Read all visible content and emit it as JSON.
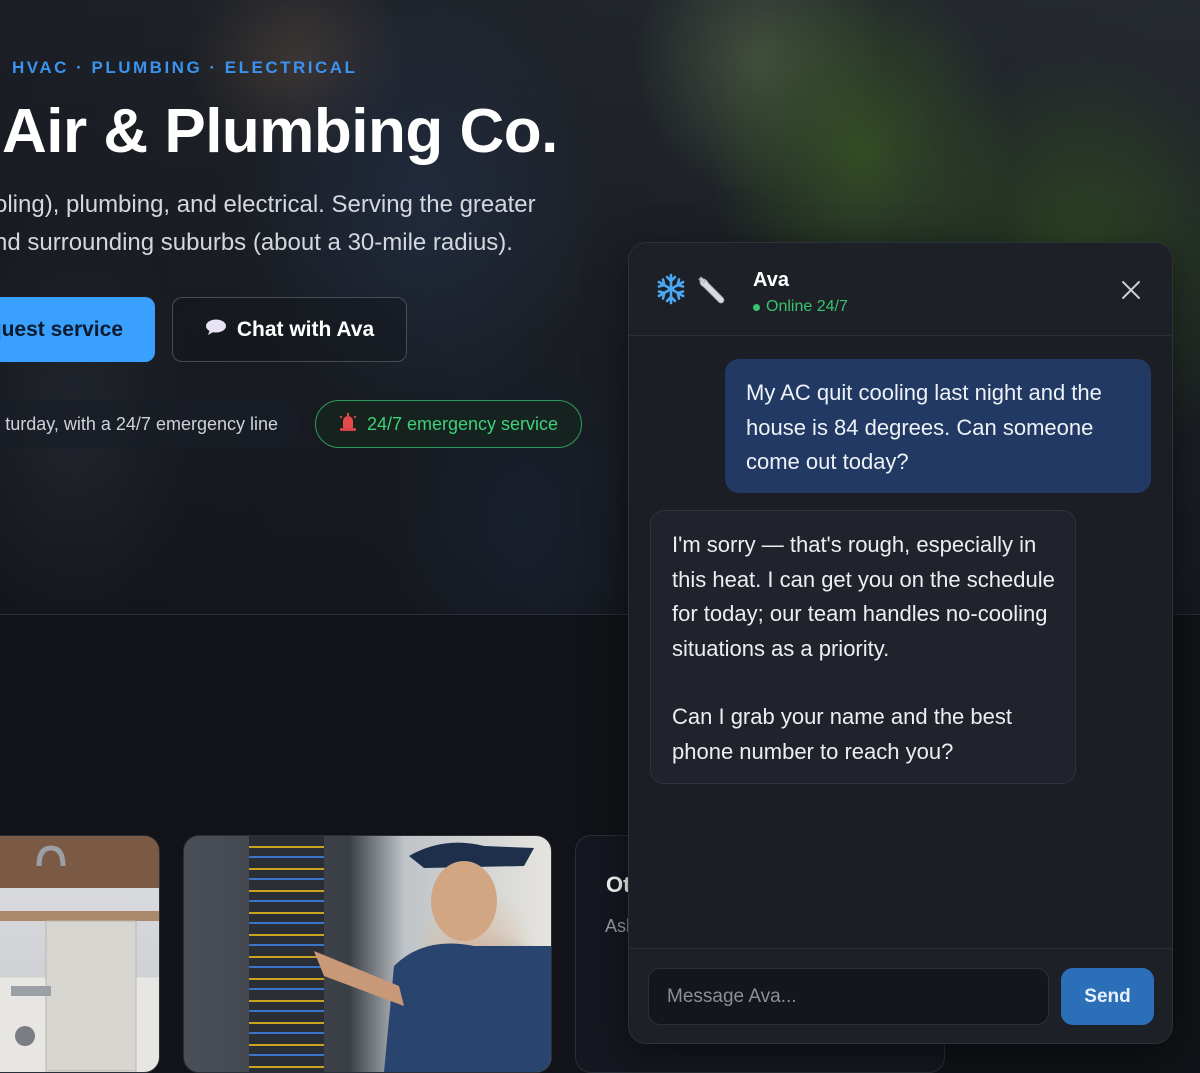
{
  "hero": {
    "eyebrow": "HVAC · PLUMBING · ELECTRICAL",
    "title": "Air & Plumbing Co.",
    "desc_line1": "oling), plumbing, and electrical. Serving the greater",
    "desc_line2": "nd surrounding suburbs (about a 30-mile radius).",
    "primary_button": "quest service",
    "secondary_button": "Chat with Ava",
    "hours_pill": "turday, with a 24/7 emergency line",
    "emergency_pill": "24/7 emergency service"
  },
  "cards": {
    "card3_title": "Ot",
    "card3_sub": "Ask"
  },
  "chat": {
    "agent_name": "Ava",
    "status": "Online 24/7",
    "user_message": "My AC quit cooling last night and the house is 84 degrees. Can someone come out today?",
    "bot_message_p1": "I'm sorry — that's rough, especially in this heat. I can get you on the schedule for today; our team handles no-cooling situations as a priority.",
    "bot_message_p2": "Can I grab your name and the best phone number to reach you?",
    "input_placeholder": "Message Ava...",
    "send_label": "Send"
  },
  "icons": {
    "snowflake": "snowflake-icon",
    "wrench": "wrench-icon",
    "close": "close-icon",
    "speech": "speech-bubble-icon",
    "siren": "siren-icon"
  },
  "colors": {
    "accent": "#3aa0ff",
    "status_green": "#39c36e",
    "user_bubble": "#223a63",
    "send_button": "#2a6fb8"
  }
}
